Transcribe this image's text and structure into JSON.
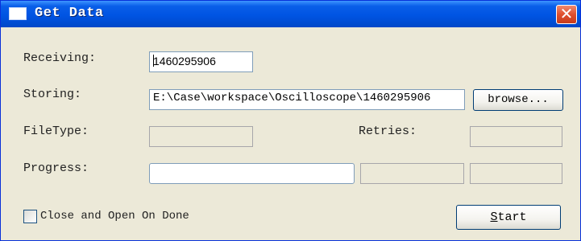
{
  "window": {
    "title": "Get Data",
    "close_glyph": "✕"
  },
  "receiving": {
    "label": "Receiving:",
    "value": "1460295906"
  },
  "storing": {
    "label": "Storing:",
    "value": "E:\\Case\\workspace\\Oscilloscope\\1460295906"
  },
  "browse_button": {
    "label": "browse..."
  },
  "filetype": {
    "label": "FileType:",
    "value": ""
  },
  "retries": {
    "label": "Retries:",
    "value": ""
  },
  "progress": {
    "label": "Progress:",
    "fraction": 0,
    "field_a": "",
    "field_b": ""
  },
  "close_on_done": {
    "label": "Close and Open On Done",
    "checked": false
  },
  "start_button": {
    "label_mnemonic": "S",
    "label_rest": "tart"
  },
  "colors": {
    "titlebar": "#0054e3",
    "window_bg": "#ece9d8",
    "close_button": "#e0502e"
  }
}
